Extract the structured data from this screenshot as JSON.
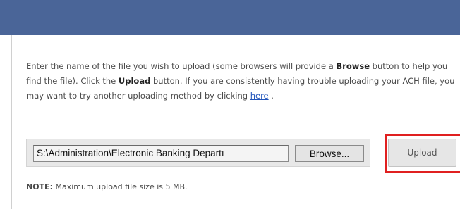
{
  "instructions": {
    "part1": "Enter the name of the file you wish to upload (some browsers will provide a ",
    "browse_word": "Browse",
    "part2": " button to help you find the file). Click the ",
    "upload_word": "Upload",
    "part3": " button. If you are consistently having trouble uploading your ACH file, you may want to try another uploading method by clicking ",
    "link_text": "here",
    "part4": " ."
  },
  "file_input": {
    "value": "S:\\Administration\\Electronic Banking Departı"
  },
  "browse_button": {
    "label": "Browse..."
  },
  "upload_button": {
    "label": "Upload"
  },
  "note": {
    "label": "NOTE:",
    "text": " Maximum upload file size is 5 MB."
  },
  "colors": {
    "header": "#4a6598",
    "highlight": "#e02020",
    "link": "#2255bb"
  }
}
